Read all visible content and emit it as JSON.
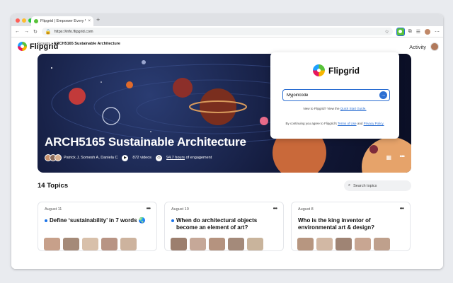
{
  "browser": {
    "tab_title": "Flipgrid | Empower Every Voice",
    "tab_close": "×",
    "new_tab": "+",
    "url": "https://info.flipgrid.com",
    "traffic_lights": [
      "#ff5f57",
      "#febc2e",
      "#28c840"
    ]
  },
  "site": {
    "logo_text": "Flipgrid",
    "activity_label": "Activity"
  },
  "breadcrumb": {
    "root": "Groups",
    "separator": "/",
    "current": "ARCH5165 Sustainable Architecture"
  },
  "hero": {
    "title": "ARCH5165 Sustainable Architecture",
    "members": "Patrick J, Somesh A, Daniela C",
    "videos": "872 videos",
    "engagement_value": "94.7 hours",
    "engagement_suffix": "of engagement"
  },
  "topics": {
    "heading": "14 Topics",
    "search_placeholder": "Search topics",
    "cards": [
      {
        "date": "August 11",
        "title": "Define ‘sustainability’ in 7 words 🌏"
      },
      {
        "date": "August 10",
        "title": "When do architectural objects become an element of art?"
      },
      {
        "date": "August 8",
        "title": "Who is the king inventor of environmental art & design?"
      }
    ]
  },
  "popup": {
    "logo_text": "Flipgrid",
    "join_value": "Myjoincode",
    "hint_prefix": "New to Flipgrid? View the",
    "hint_link": "Quick Start Guide.",
    "terms_prefix": "By continuing you agree to Flipgrid's",
    "terms_link": "Terms of Use",
    "terms_and": "and",
    "privacy_link": "Privacy Policy."
  },
  "colors": {
    "accent": "#2b6ed2",
    "brand_green": "#58c23a",
    "hero_bg": "#12193a"
  }
}
